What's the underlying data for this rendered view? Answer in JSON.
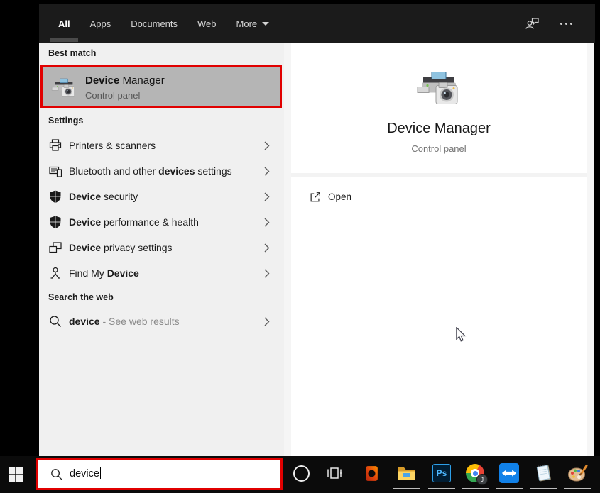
{
  "tab_bar": {
    "tabs": [
      {
        "label": "All",
        "selected": true
      },
      {
        "label": "Apps",
        "selected": false
      },
      {
        "label": "Documents",
        "selected": false
      },
      {
        "label": "Web",
        "selected": false
      },
      {
        "label": "More",
        "selected": false,
        "has_dropdown": true
      }
    ],
    "right_icons": [
      "feedback-icon",
      "more-options-icon"
    ]
  },
  "best_match": {
    "header": "Best match",
    "item": {
      "icon": "device-manager-icon",
      "title_match": "Device",
      "title_rest": " Manager",
      "subtitle": "Control panel",
      "highlighted": true,
      "annotated_red_border": true
    }
  },
  "settings": {
    "header": "Settings",
    "items": [
      {
        "icon": "printer-icon",
        "pre": "Printers & scanners",
        "match": "",
        "post": ""
      },
      {
        "icon": "bluetooth-devices-icon",
        "pre": "Bluetooth and other ",
        "match": "devices",
        "post": " settings"
      },
      {
        "icon": "shield-icon",
        "pre": "",
        "match": "Device",
        "post": " security"
      },
      {
        "icon": "shield-icon",
        "pre": "",
        "match": "Device",
        "post": " performance & health"
      },
      {
        "icon": "device-privacy-icon",
        "pre": "",
        "match": "Device",
        "post": " privacy settings"
      },
      {
        "icon": "find-device-icon",
        "pre": "Find My ",
        "match": "Device",
        "post": ""
      }
    ]
  },
  "web_search": {
    "header": "Search the web",
    "item": {
      "icon": "search-icon",
      "match": "device",
      "post": " - See web results"
    }
  },
  "preview": {
    "icon": "device-manager-icon",
    "title": "Device Manager",
    "subtitle": "Control panel",
    "open_action": {
      "icon": "open-icon",
      "label": "Open"
    }
  },
  "search_box": {
    "icon": "search-icon",
    "value": "device",
    "annotated_red_border": true
  },
  "taskbar": {
    "start": "start-button",
    "items": [
      {
        "name": "cortana",
        "running": false
      },
      {
        "name": "task-view",
        "running": false
      },
      {
        "name": "office",
        "running": false
      },
      {
        "name": "file-explorer",
        "running": true
      },
      {
        "name": "photoshop",
        "label": "Ps",
        "running": true
      },
      {
        "name": "chrome",
        "badge": "J",
        "running": true
      },
      {
        "name": "teamviewer",
        "running": true
      },
      {
        "name": "notepad",
        "running": true
      },
      {
        "name": "paint",
        "running": true
      }
    ]
  },
  "colors": {
    "annotation_red": "#e10000",
    "highlight_gray": "#b5b5b5",
    "panel_bg": "#f0f0f0",
    "dark_bar": "#1b1b1b",
    "taskbar_bg": "#0b0b0b"
  }
}
